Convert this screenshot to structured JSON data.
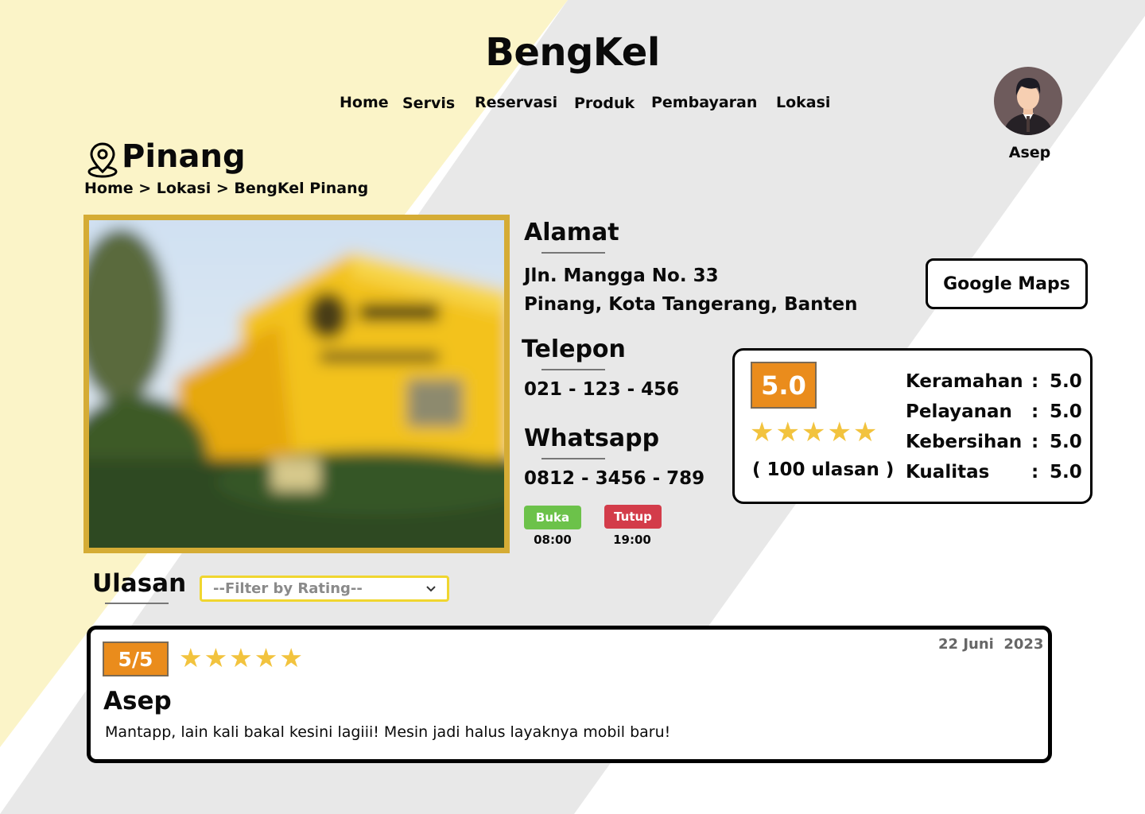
{
  "app": {
    "brand": "BengKel",
    "colors": {
      "cream": "#fbf4c8",
      "gray": "#e8e8e8",
      "accent_gold": "#d5ac35",
      "orange": "#ea8c1c",
      "open_green": "#6cc24a",
      "close_red": "#d33c4a",
      "star": "#f2c33e"
    }
  },
  "nav": {
    "items": [
      {
        "label": "Home"
      },
      {
        "label": "Servis"
      },
      {
        "label": "Reservasi"
      },
      {
        "label": "Produk"
      },
      {
        "label": "Pembayaran"
      },
      {
        "label": "Lokasi"
      }
    ]
  },
  "user": {
    "name": "Asep",
    "avatar_icon": "user-avatar-icon"
  },
  "location": {
    "icon": "map-pin-icon",
    "title": "Pinang",
    "breadcrumb": [
      "Home",
      " > ",
      "Lokasi",
      " > ",
      "BengKel Pinang"
    ]
  },
  "details": {
    "alamat_heading": "Alamat",
    "address_line1": "Jln. Mangga No. 33",
    "address_line2": "Pinang, Kota Tangerang, Banten",
    "maps_button": "Google Maps",
    "telepon_heading": "Telepon",
    "phone": "021 - 123 - 456",
    "whatsapp_heading": "Whatsapp",
    "whatsapp": "0812 - 3456 - 789",
    "open_label": "Buka",
    "open_time": "08:00",
    "close_label": "Tutup",
    "close_time": "19:00"
  },
  "rating": {
    "score": "5.0",
    "stars": 5,
    "stars_text": "★★★★★",
    "count_text": "( 100 ulasan )",
    "criteria": [
      {
        "name": "Keramahan",
        "sep": ":",
        "value": "5.0"
      },
      {
        "name": "Pelayanan",
        "sep": ":",
        "value": "5.0"
      },
      {
        "name": "Kebersihan",
        "sep": ":",
        "value": "5.0"
      },
      {
        "name": "Kualitas",
        "sep": ":",
        "value": "5.0"
      }
    ]
  },
  "reviews": {
    "heading": "Ulasan",
    "filter_placeholder": "--Filter by Rating--",
    "items": [
      {
        "score": "5/5",
        "stars": 5,
        "stars_text": "★★★★★",
        "date": "22 Juni  2023",
        "author": "Asep",
        "text": "Mantapp, lain kali bakal kesini lagiii! Mesin jadi halus layaknya mobil baru!"
      }
    ]
  }
}
